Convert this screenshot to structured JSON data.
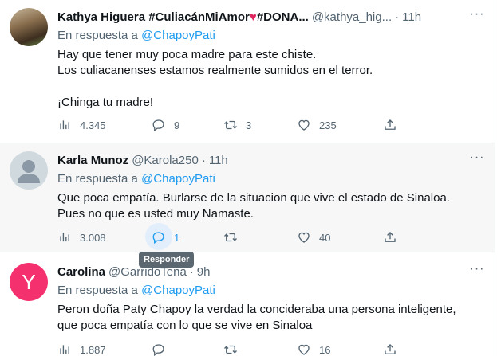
{
  "tweets": [
    {
      "name": "Kathya Higuera #CuliacánMiAmor",
      "name_suffix": "#DONA...",
      "handle": "@kathya_hig...",
      "dot": "·",
      "time": "11h",
      "reply_prefix": "En respuesta a",
      "reply_mention": "@ChapoyPati",
      "text": "Hay que tener muy poca madre para este chiste.\nLos culiacanenses estamos realmente sumidos en el terror.\n\n¡Chinga tu madre!",
      "views": "4.345",
      "replies": "9",
      "retweets": "3",
      "likes": "235",
      "avatar_icon": "photo-avatar"
    },
    {
      "name": "Karla Munoz",
      "handle": "@Karola250",
      "dot": "·",
      "time": "11h",
      "reply_prefix": "En respuesta a",
      "reply_mention": "@ChapoyPati",
      "text": "Que poca empatía. Burlarse de la situacion que vive el estado de Sinaloa.\nPues no que es usted muy Namaste.",
      "views": "3.008",
      "replies": "1",
      "retweets": "",
      "likes": "40",
      "avatar_icon": "default-avatar"
    },
    {
      "name": "Carolina",
      "handle": "@GarridoTena",
      "dot": "·",
      "time": "9h",
      "reply_prefix": "En respuesta a",
      "reply_mention": "@ChapoyPati",
      "text": "Peron doña Paty Chapoy la verdad la concideraba una persona inteligente,\nque poca empatía con lo que se vive en Sinaloa",
      "views": "1.887",
      "replies": "",
      "retweets": "",
      "likes": "16",
      "avatar_letter": "Y",
      "avatar_color": "#f4306f"
    }
  ],
  "tooltip": "Responder",
  "more_label": "···",
  "colors": {
    "accent": "#1d9bf0",
    "heart": "#e0245e",
    "muted": "#536471"
  }
}
